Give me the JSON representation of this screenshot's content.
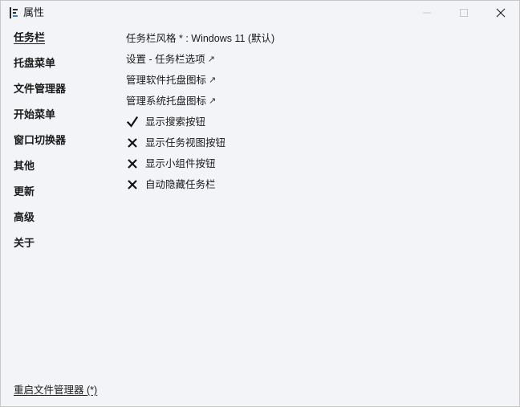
{
  "window": {
    "title": "属性"
  },
  "sidebar": {
    "items": [
      {
        "label": "任务栏",
        "active": true
      },
      {
        "label": "托盘菜单",
        "active": false
      },
      {
        "label": "文件管理器",
        "active": false
      },
      {
        "label": "开始菜单",
        "active": false
      },
      {
        "label": "窗口切换器",
        "active": false
      },
      {
        "label": "其他",
        "active": false
      },
      {
        "label": "更新",
        "active": false
      },
      {
        "label": "高级",
        "active": false
      },
      {
        "label": "关于",
        "active": false
      }
    ]
  },
  "main": {
    "style_row": {
      "label": "任务栏风格 *",
      "separator": " : ",
      "value": "Windows 11 (默认)"
    },
    "links": [
      {
        "label": "设置 - 任务栏选项",
        "arrow": "↗"
      },
      {
        "label": "管理软件托盘图标",
        "arrow": "↗"
      },
      {
        "label": "管理系统托盘图标",
        "arrow": "↗"
      }
    ],
    "options": [
      {
        "label": "显示搜索按钮",
        "checked": true
      },
      {
        "label": "显示任务视图按钮",
        "checked": false
      },
      {
        "label": "显示小组件按钮",
        "checked": false
      },
      {
        "label": "自动隐藏任务栏",
        "checked": false
      }
    ]
  },
  "footer": {
    "restart_label": "重启文件管理器 (*)"
  },
  "icons": {
    "app": "app-icon",
    "checked": "checkmark-icon",
    "unchecked": "cross-icon"
  },
  "colors": {
    "background": "#f3f4f8",
    "text": "#1a1a1a",
    "close_icon": "#1a1a1a"
  }
}
